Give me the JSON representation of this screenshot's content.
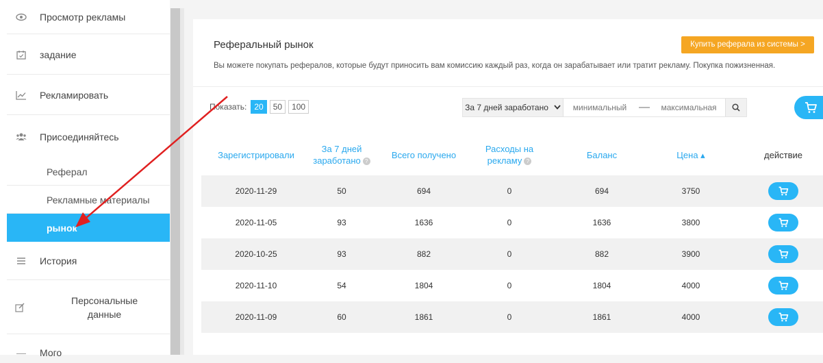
{
  "sidebar": {
    "items": [
      {
        "label": "Просмотр рекламы",
        "icon": "eye-icon"
      },
      {
        "label": "задание",
        "icon": "calendar-icon"
      },
      {
        "label": "Рекламировать",
        "icon": "chart-icon"
      },
      {
        "label": "Присоединяйтесь",
        "icon": "users-icon"
      }
    ],
    "sub": [
      {
        "label": "Реферал"
      },
      {
        "label": "Рекламные материалы"
      },
      {
        "label": "рынок"
      }
    ],
    "history": "История",
    "personal": "Персональные данные",
    "more": "Мого"
  },
  "market": {
    "title": "Реферальный рынок",
    "description": "Вы можете покупать рефералов, которые будут приносить вам комиссию каждый раз, когда он зарабатывает или тратит рекламу. Покупка пожизненная.",
    "buy_system_label": "Купить реферала из системы >",
    "show_label": "Показать:",
    "page_sizes": [
      "20",
      "50",
      "100"
    ],
    "filter_select": "За 7 дней заработано",
    "min_placeholder": "минимальный",
    "max_placeholder": "максимальная",
    "dash": "—"
  },
  "table": {
    "headers": {
      "registered": "Зарегистрировали",
      "earned7_l1": "За 7 дней",
      "earned7_l2": "заработано",
      "total": "Всего получено",
      "spend_l1": "Расходы на",
      "spend_l2": "рекламу",
      "balance": "Баланс",
      "price": "Цена ▴",
      "action": "действие"
    },
    "rows": [
      {
        "date": "2020-11-29",
        "earned": "50",
        "total": "694",
        "spend": "0",
        "balance": "694",
        "price": "3750"
      },
      {
        "date": "2020-11-05",
        "earned": "93",
        "total": "1636",
        "spend": "0",
        "balance": "1636",
        "price": "3800"
      },
      {
        "date": "2020-10-25",
        "earned": "93",
        "total": "882",
        "spend": "0",
        "balance": "882",
        "price": "3900"
      },
      {
        "date": "2020-11-10",
        "earned": "54",
        "total": "1804",
        "spend": "0",
        "balance": "1804",
        "price": "4000"
      },
      {
        "date": "2020-11-09",
        "earned": "60",
        "total": "1861",
        "spend": "0",
        "balance": "1861",
        "price": "4000"
      }
    ]
  },
  "colors": {
    "accent": "#29b6f6",
    "orange": "#f5a623",
    "arrow": "#e02020"
  }
}
